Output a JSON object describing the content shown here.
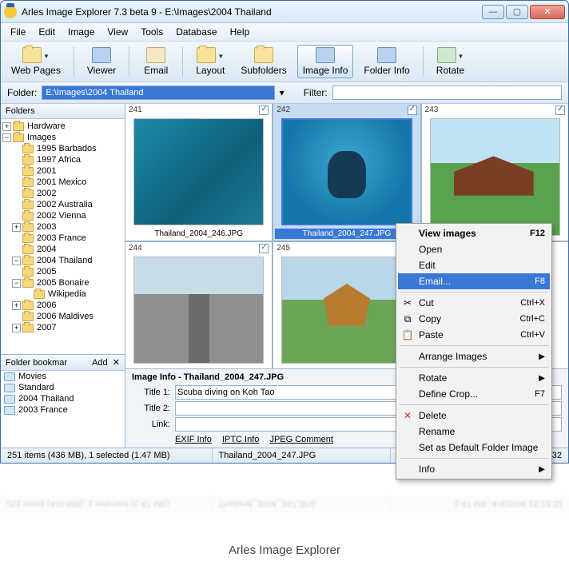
{
  "title": "Arles Image Explorer 7.3 beta 9 - E:\\Images\\2004 Thailand",
  "menu": [
    "File",
    "Edit",
    "Image",
    "View",
    "Tools",
    "Database",
    "Help"
  ],
  "toolbar": [
    {
      "label": "Web Pages",
      "dropdown": true,
      "icon": "folder"
    },
    {
      "label": "Viewer",
      "dropdown": false,
      "icon": "blue"
    },
    {
      "label": "Email",
      "dropdown": false,
      "icon": "mail"
    },
    {
      "label": "Layout",
      "dropdown": true,
      "icon": "folder"
    },
    {
      "label": "Subfolders",
      "dropdown": false,
      "icon": "folder"
    },
    {
      "label": "Image Info",
      "dropdown": false,
      "icon": "blue",
      "active": true
    },
    {
      "label": "Folder Info",
      "dropdown": false,
      "icon": "blue"
    },
    {
      "label": "Rotate",
      "dropdown": true,
      "icon": "rotate"
    }
  ],
  "pathbar": {
    "label": "Folder:",
    "value": "E:\\Images\\2004 Thailand",
    "filter_label": "Filter:",
    "filter_value": ""
  },
  "folders_hdr": "Folders",
  "tree": [
    {
      "label": "Hardware",
      "depth": 0,
      "exp": "+"
    },
    {
      "label": "Images",
      "depth": 0,
      "exp": "−"
    },
    {
      "label": "1995 Barbados",
      "depth": 1,
      "exp": ""
    },
    {
      "label": "1997 Africa",
      "depth": 1,
      "exp": ""
    },
    {
      "label": "2001",
      "depth": 1,
      "exp": ""
    },
    {
      "label": "2001 Mexico",
      "depth": 1,
      "exp": ""
    },
    {
      "label": "2002",
      "depth": 1,
      "exp": ""
    },
    {
      "label": "2002 Australia",
      "depth": 1,
      "exp": ""
    },
    {
      "label": "2002 Vienna",
      "depth": 1,
      "exp": ""
    },
    {
      "label": "2003",
      "depth": 1,
      "exp": "+"
    },
    {
      "label": "2003 France",
      "depth": 1,
      "exp": ""
    },
    {
      "label": "2004",
      "depth": 1,
      "exp": ""
    },
    {
      "label": "2004 Thailand",
      "depth": 1,
      "exp": "−"
    },
    {
      "label": "2005",
      "depth": 1,
      "exp": ""
    },
    {
      "label": "2005 Bonaire",
      "depth": 1,
      "exp": "−"
    },
    {
      "label": "Wikipedia",
      "depth": 2,
      "exp": ""
    },
    {
      "label": "2006",
      "depth": 1,
      "exp": "+"
    },
    {
      "label": "2006 Maldives",
      "depth": 1,
      "exp": ""
    },
    {
      "label": "2007",
      "depth": 1,
      "exp": "+"
    }
  ],
  "bookmarks_hdr": "Folder bookmar",
  "bookmarks_add": "Add",
  "bookmarks": [
    "Movies",
    "Standard",
    "2004 Thailand",
    "2003 France"
  ],
  "thumbs": [
    {
      "num": "241",
      "cap": "Thailand_2004_246.JPG",
      "cls": "underwater",
      "sel": false
    },
    {
      "num": "242",
      "cap": "Thailand_2004_247.JPG",
      "cls": "diver",
      "sel": true
    },
    {
      "num": "243",
      "cap": "",
      "cls": "hut",
      "sel": false
    },
    {
      "num": "244",
      "cap": "",
      "cls": "street",
      "sel": false
    },
    {
      "num": "245",
      "cap": "",
      "cls": "temple",
      "sel": false
    }
  ],
  "info": {
    "header": "Image Info - Thailand_2004_247.JPG",
    "title1_label": "Title 1:",
    "title1": "Scuba diving on Koh Tao",
    "title2_label": "Title 2:",
    "title2": "",
    "link_label": "Link:",
    "link": "",
    "tabs": [
      "EXIF Info",
      "IPTC Info",
      "JPEG Comment"
    ]
  },
  "status": {
    "left": "251 items (436 MB), 1 selected (1.47 MB)",
    "mid": "Thailand_2004_247.JPG",
    "right": "1.47 MB, 4/4/2004 15:23:32"
  },
  "ctx": [
    {
      "label": "View images",
      "shortcut": "F12",
      "bold": true
    },
    {
      "label": "Open"
    },
    {
      "label": "Edit"
    },
    {
      "label": "Email...",
      "shortcut": "F8",
      "hl": true
    },
    {
      "sep": true
    },
    {
      "label": "Cut",
      "shortcut": "Ctrl+X",
      "icon": "✂"
    },
    {
      "label": "Copy",
      "shortcut": "Ctrl+C",
      "icon": "⧉"
    },
    {
      "label": "Paste",
      "shortcut": "Ctrl+V",
      "icon": "📋"
    },
    {
      "sep": true
    },
    {
      "label": "Arrange Images",
      "submenu": true
    },
    {
      "sep": true
    },
    {
      "label": "Rotate",
      "submenu": true
    },
    {
      "label": "Define Crop...",
      "shortcut": "F7"
    },
    {
      "sep": true
    },
    {
      "label": "Delete",
      "icon": "✕",
      "iconcolor": "#c33"
    },
    {
      "label": "Rename"
    },
    {
      "label": "Set as Default Folder Image"
    },
    {
      "sep": true
    },
    {
      "label": "Info",
      "submenu": true
    }
  ],
  "app_caption": "Arles Image Explorer"
}
